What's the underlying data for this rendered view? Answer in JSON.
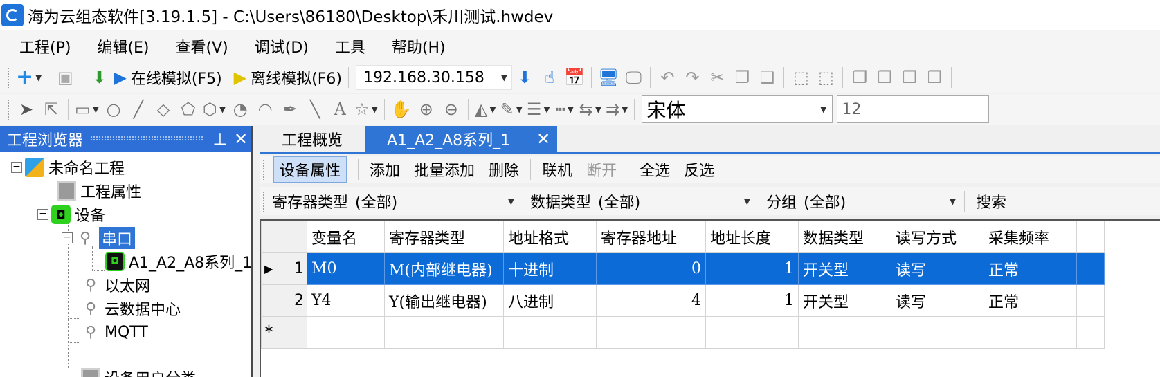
{
  "window": {
    "title": "海为云组态软件[3.19.1.5] - C:\\Users\\86180\\Desktop\\禾川测试.hwdev"
  },
  "menu": [
    {
      "label": "工程(P)"
    },
    {
      "label": "编辑(E)"
    },
    {
      "label": "查看(V)"
    },
    {
      "label": "调试(D)"
    },
    {
      "label": "工具"
    },
    {
      "label": "帮助(H)"
    }
  ],
  "toolbar1": {
    "online_sim": "在线模拟(F5)",
    "offline_sim": "离线模拟(F6)",
    "ip": "192.168.30.158"
  },
  "toolbar2": {
    "font": "宋体",
    "font_size": "12",
    "text_tool": "A"
  },
  "browser": {
    "title": "工程浏览器",
    "pin": "ꟷ",
    "nodes": {
      "project": "未命名工程",
      "project_props": "工程属性",
      "device": "设备",
      "serial": "串口",
      "serial_device": "A1_A2_A8系列_1",
      "ethernet": "以太网",
      "cloud_data": "云数据中心",
      "mqtt": "MQTT",
      "user_category": "设备用户分类"
    }
  },
  "tabs": [
    {
      "label": "工程概览",
      "active": false
    },
    {
      "label": "A1_A2_A8系列_1",
      "active": true
    }
  ],
  "ops": {
    "device_props": "设备属性",
    "add": "添加",
    "batch_add": "批量添加",
    "delete": "删除",
    "online": "联机",
    "disconnect": "断开",
    "select_all": "全选",
    "invert": "反选"
  },
  "filters": {
    "reg_type_label": "寄存器类型",
    "reg_type_value": "(全部)",
    "data_type_label": "数据类型",
    "data_type_value": "(全部)",
    "group_label": "分组",
    "group_value": "(全部)",
    "search": "搜索"
  },
  "grid": {
    "columns": [
      "变量名",
      "寄存器类型",
      "地址格式",
      "寄存器地址",
      "地址长度",
      "数据类型",
      "读写方式",
      "采集频率"
    ],
    "rows": [
      {
        "index": "1",
        "name": "M0",
        "reg_type": "M(内部继电器)",
        "addr_format": "十进制",
        "address": "0",
        "length": "1",
        "data_type": "开关型",
        "rw": "读写",
        "freq": "正常",
        "selected": true
      },
      {
        "index": "2",
        "name": "Y4",
        "reg_type": "Y(输出继电器)",
        "addr_format": "八进制",
        "address": "4",
        "length": "1",
        "data_type": "开关型",
        "rw": "读写",
        "freq": "正常",
        "selected": false
      }
    ],
    "new_row_marker": "*"
  },
  "colors": {
    "accent": "#2f75d6",
    "selection": "#0c6bd6"
  }
}
